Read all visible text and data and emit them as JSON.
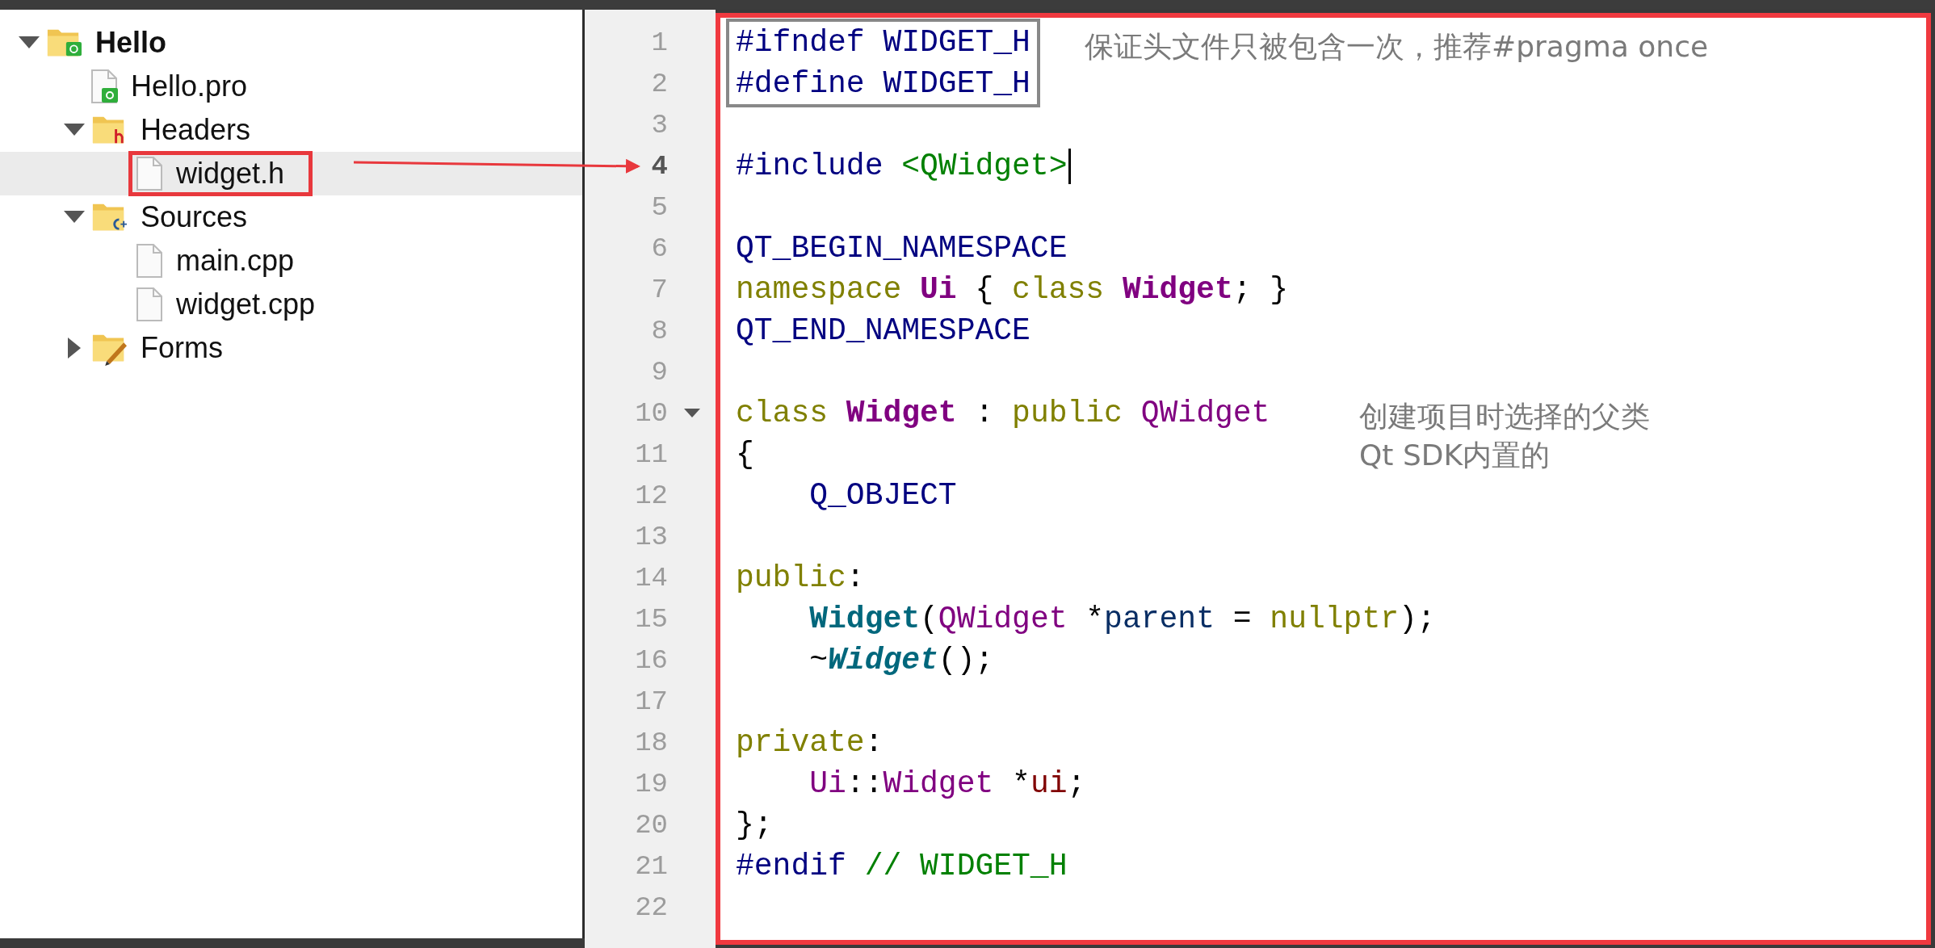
{
  "project_tree": [
    {
      "label": "Hello",
      "kind": "project",
      "expanded": true,
      "selected": false,
      "highlighted": false,
      "children": [
        {
          "label": "Hello.pro",
          "kind": "pro-file",
          "selected": false,
          "highlighted": false
        },
        {
          "label": "Headers",
          "kind": "header-folder",
          "expanded": true,
          "selected": false,
          "highlighted": false,
          "children": [
            {
              "label": "widget.h",
              "kind": "file",
              "selected": true,
              "highlighted": true
            }
          ]
        },
        {
          "label": "Sources",
          "kind": "source-folder",
          "expanded": true,
          "selected": false,
          "highlighted": false,
          "children": [
            {
              "label": "main.cpp",
              "kind": "file",
              "selected": false,
              "highlighted": false
            },
            {
              "label": "widget.cpp",
              "kind": "file",
              "selected": false,
              "highlighted": false
            }
          ]
        },
        {
          "label": "Forms",
          "kind": "forms-folder",
          "expanded": false,
          "selected": false,
          "highlighted": false
        }
      ]
    }
  ],
  "editor": {
    "lines": [
      {
        "number": "1",
        "current": false,
        "foldable": false,
        "boxed": true,
        "tokens": [
          {
            "text": "#ifndef WIDGET_H",
            "kind": "preproc"
          }
        ]
      },
      {
        "number": "2",
        "current": false,
        "foldable": false,
        "boxed": true,
        "tokens": [
          {
            "text": "#define WIDGET_H",
            "kind": "preproc"
          }
        ]
      },
      {
        "number": "3",
        "current": false,
        "foldable": false,
        "boxed": false
      },
      {
        "number": "4",
        "current": true,
        "foldable": false,
        "boxed": false,
        "tokens": [
          {
            "text": "#include ",
            "kind": "preproc"
          },
          {
            "text": "<QWidget>",
            "kind": "include"
          }
        ]
      },
      {
        "number": "5",
        "current": false,
        "foldable": false,
        "boxed": false
      },
      {
        "number": "6",
        "current": false,
        "foldable": false,
        "boxed": false,
        "tokens": [
          {
            "text": "QT_BEGIN_NAMESPACE",
            "kind": "preproc"
          }
        ]
      },
      {
        "number": "7",
        "current": false,
        "foldable": false,
        "boxed": false,
        "tokens": [
          {
            "text": "namespace ",
            "kind": "keyword"
          },
          {
            "text": "Ui",
            "kind": "class"
          },
          {
            "text": " { ",
            "kind": "plain"
          },
          {
            "text": "class ",
            "kind": "keyword"
          },
          {
            "text": "Widget",
            "kind": "class"
          },
          {
            "text": "; }",
            "kind": "plain"
          }
        ]
      },
      {
        "number": "8",
        "current": false,
        "foldable": false,
        "boxed": false,
        "tokens": [
          {
            "text": "QT_END_NAMESPACE",
            "kind": "preproc"
          }
        ]
      },
      {
        "number": "9",
        "current": false,
        "foldable": false,
        "boxed": false
      },
      {
        "number": "10",
        "current": false,
        "foldable": true,
        "boxed": false,
        "tokens": [
          {
            "text": "class ",
            "kind": "keyword"
          },
          {
            "text": "Widget",
            "kind": "class"
          },
          {
            "text": " : ",
            "kind": "plain"
          },
          {
            "text": "public ",
            "kind": "keyword"
          },
          {
            "text": "QWidget",
            "kind": "type"
          }
        ]
      },
      {
        "number": "11",
        "current": false,
        "foldable": false,
        "boxed": false,
        "tokens": [
          {
            "text": "{",
            "kind": "plain"
          }
        ]
      },
      {
        "number": "12",
        "current": false,
        "foldable": false,
        "boxed": false,
        "tokens": [
          {
            "text": "    Q_OBJECT",
            "kind": "preproc"
          }
        ]
      },
      {
        "number": "13",
        "current": false,
        "foldable": false,
        "boxed": false
      },
      {
        "number": "14",
        "current": false,
        "foldable": false,
        "boxed": false,
        "tokens": [
          {
            "text": "public",
            "kind": "keyword"
          },
          {
            "text": ":",
            "kind": "plain"
          }
        ]
      },
      {
        "number": "15",
        "current": false,
        "foldable": false,
        "boxed": false,
        "tokens": [
          {
            "text": "    Widget",
            "kind": "function"
          },
          {
            "text": "(",
            "kind": "plain"
          },
          {
            "text": "QWidget",
            "kind": "type"
          },
          {
            "text": " *",
            "kind": "plain"
          },
          {
            "text": "parent",
            "kind": "param"
          },
          {
            "text": " = ",
            "kind": "plain"
          },
          {
            "text": "nullptr",
            "kind": "keyword"
          },
          {
            "text": ");",
            "kind": "plain"
          }
        ]
      },
      {
        "number": "16",
        "current": false,
        "foldable": false,
        "boxed": false,
        "tokens": [
          {
            "text": "    ~",
            "kind": "plain"
          },
          {
            "text": "Widget",
            "kind": "destructor"
          },
          {
            "text": "();",
            "kind": "plain"
          }
        ]
      },
      {
        "number": "17",
        "current": false,
        "foldable": false,
        "boxed": false
      },
      {
        "number": "18",
        "current": false,
        "foldable": false,
        "boxed": false,
        "tokens": [
          {
            "text": "private",
            "kind": "keyword"
          },
          {
            "text": ":",
            "kind": "plain"
          }
        ]
      },
      {
        "number": "19",
        "current": false,
        "foldable": false,
        "boxed": false,
        "tokens": [
          {
            "text": "    Ui",
            "kind": "type"
          },
          {
            "text": "::",
            "kind": "plain"
          },
          {
            "text": "Widget",
            "kind": "type"
          },
          {
            "text": " *",
            "kind": "plain"
          },
          {
            "text": "ui",
            "kind": "member"
          },
          {
            "text": ";",
            "kind": "plain"
          }
        ]
      },
      {
        "number": "20",
        "current": false,
        "foldable": false,
        "boxed": false,
        "tokens": [
          {
            "text": "};",
            "kind": "plain"
          }
        ]
      },
      {
        "number": "21",
        "current": false,
        "foldable": false,
        "boxed": false,
        "tokens": [
          {
            "text": "#endif ",
            "kind": "preproc"
          },
          {
            "text": "// WIDGET_H",
            "kind": "comment"
          }
        ]
      },
      {
        "number": "22",
        "current": false,
        "foldable": false,
        "boxed": false
      }
    ]
  },
  "annotations": [
    {
      "lines": [
        "保证头文件只被包含一次，推荐#pragma once"
      ]
    },
    {
      "lines": [
        "创建项目时选择的父类",
        "Qt SDK内置的"
      ]
    }
  ]
}
